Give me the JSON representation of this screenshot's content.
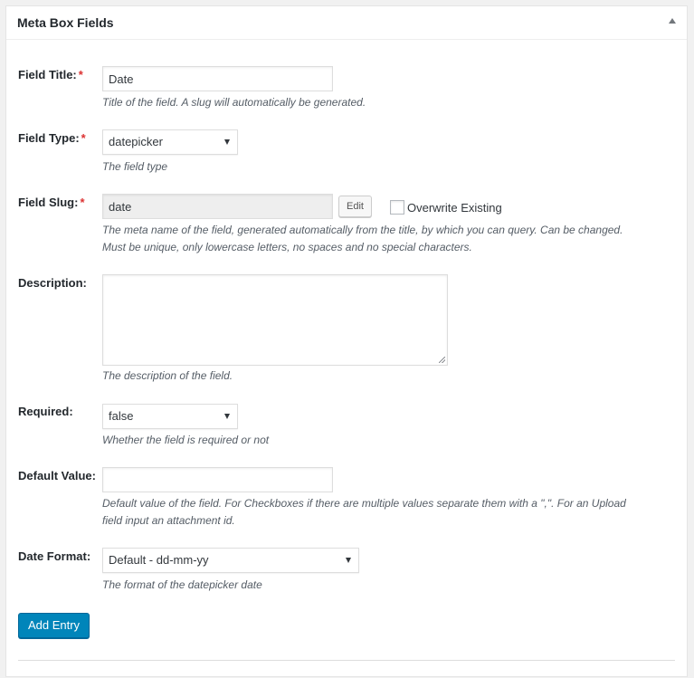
{
  "panel": {
    "title": "Meta Box Fields"
  },
  "fields": {
    "title": {
      "label": "Field Title:",
      "required": "*",
      "value": "Date",
      "hint": "Title of the field. A slug will automatically be generated."
    },
    "type": {
      "label": "Field Type:",
      "required": "*",
      "value": "datepicker",
      "hint": "The field type"
    },
    "slug": {
      "label": "Field Slug:",
      "required": "*",
      "value": "date",
      "edit_label": "Edit",
      "overwrite_label": "Overwrite Existing",
      "overwrite_checked": false,
      "hint_line1": "The meta name of the field, generated automatically from the title, by which you can query. Can be changed.",
      "hint_line2": "Must be unique, only lowercase letters, no spaces and no special characters."
    },
    "description": {
      "label": "Description:",
      "value": "",
      "hint": "The description of the field."
    },
    "required": {
      "label": "Required:",
      "value": "false",
      "hint": "Whether the field is required or not"
    },
    "default_value": {
      "label": "Default Value:",
      "value": "",
      "hint_line1": "Default value of the field. For Checkboxes if there are multiple values separate them with a \",\". For an Upload",
      "hint_line2": "field input an attachment id."
    },
    "date_format": {
      "label": "Date Format:",
      "value": "Default - dd-mm-yy",
      "hint": "The format of the datepicker date"
    }
  },
  "actions": {
    "add_entry": "Add Entry"
  },
  "colors": {
    "primary": "#0085ba",
    "required_star": "#dc3232"
  }
}
